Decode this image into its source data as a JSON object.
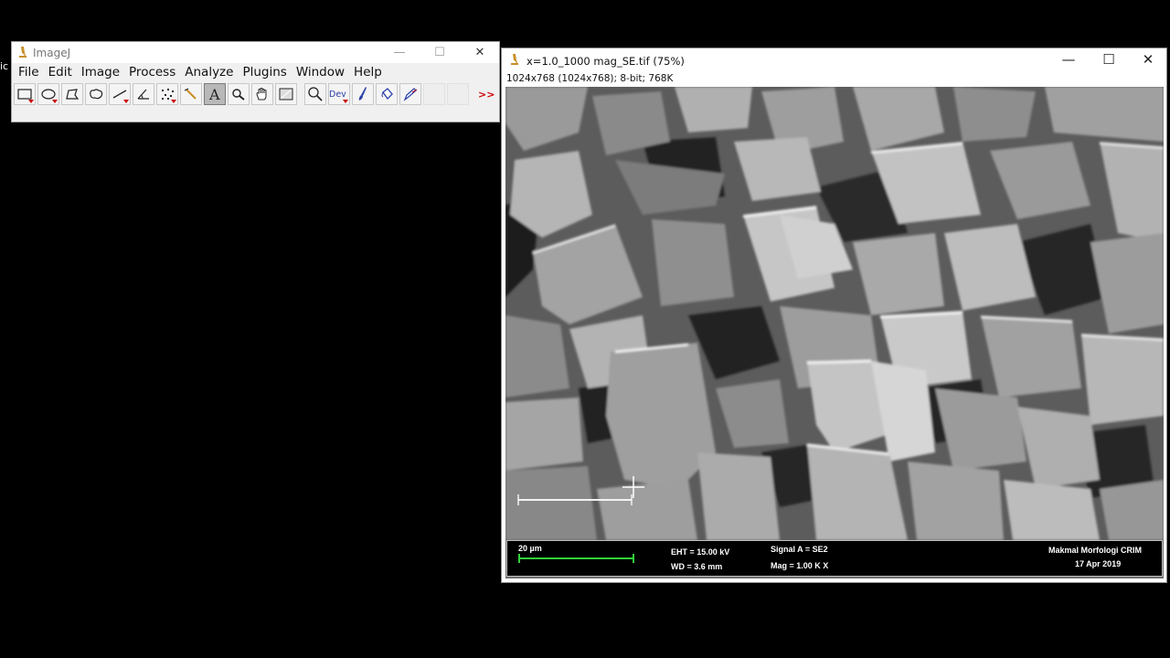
{
  "stray_text": "ic",
  "imagej": {
    "title": "ImageJ",
    "menu": [
      "File",
      "Edit",
      "Image",
      "Process",
      "Analyze",
      "Plugins",
      "Window",
      "Help"
    ],
    "tools": [
      {
        "name": "rectangle-tool-icon",
        "dropdown": true
      },
      {
        "name": "oval-tool-icon",
        "dropdown": true
      },
      {
        "name": "polygon-tool-icon",
        "dropdown": false
      },
      {
        "name": "freehand-tool-icon",
        "dropdown": false
      },
      {
        "name": "line-tool-icon",
        "dropdown": true
      },
      {
        "name": "angle-tool-icon",
        "dropdown": false
      },
      {
        "name": "point-tool-icon",
        "dropdown": true
      },
      {
        "name": "wand-tool-icon",
        "dropdown": false
      },
      {
        "name": "text-tool-icon",
        "dropdown": false,
        "selected": true
      },
      {
        "name": "magnifier-tool-icon",
        "dropdown": false
      },
      {
        "name": "hand-tool-icon",
        "dropdown": false
      },
      {
        "name": "color-picker-tool-icon",
        "dropdown": false
      },
      {
        "name": "zoom-tool-icon",
        "dropdown": false
      },
      {
        "name": "dev-tool-icon",
        "dropdown": true,
        "label": "Dev"
      },
      {
        "name": "brush-tool-icon",
        "dropdown": false
      },
      {
        "name": "flood-fill-tool-icon",
        "dropdown": false
      },
      {
        "name": "pencil-tool-icon",
        "dropdown": false
      },
      {
        "name": "empty-tool-slot-icon",
        "dropdown": false
      },
      {
        "name": "empty-tool-slot-icon",
        "dropdown": false
      }
    ],
    "more_label": ">>"
  },
  "image_window": {
    "title": "x=1.0_1000 mag_SE.tif (75%)",
    "info": "1024x768  (1024x768); 8-bit; 768K",
    "databar": {
      "scale_label": "20 µm",
      "eht": "EHT = 15.00 kV",
      "wd": "WD =  3.6 mm",
      "signal": "Signal A = SE2",
      "mag": "Mag =   1.00 K X",
      "lab": "Makmal Morfologi CRIM",
      "date": "17 Apr 2019"
    }
  },
  "colors": {
    "desktop": "#000000",
    "scale_bar": "#2fd13a",
    "selected_tool": "#b8b8b8"
  }
}
